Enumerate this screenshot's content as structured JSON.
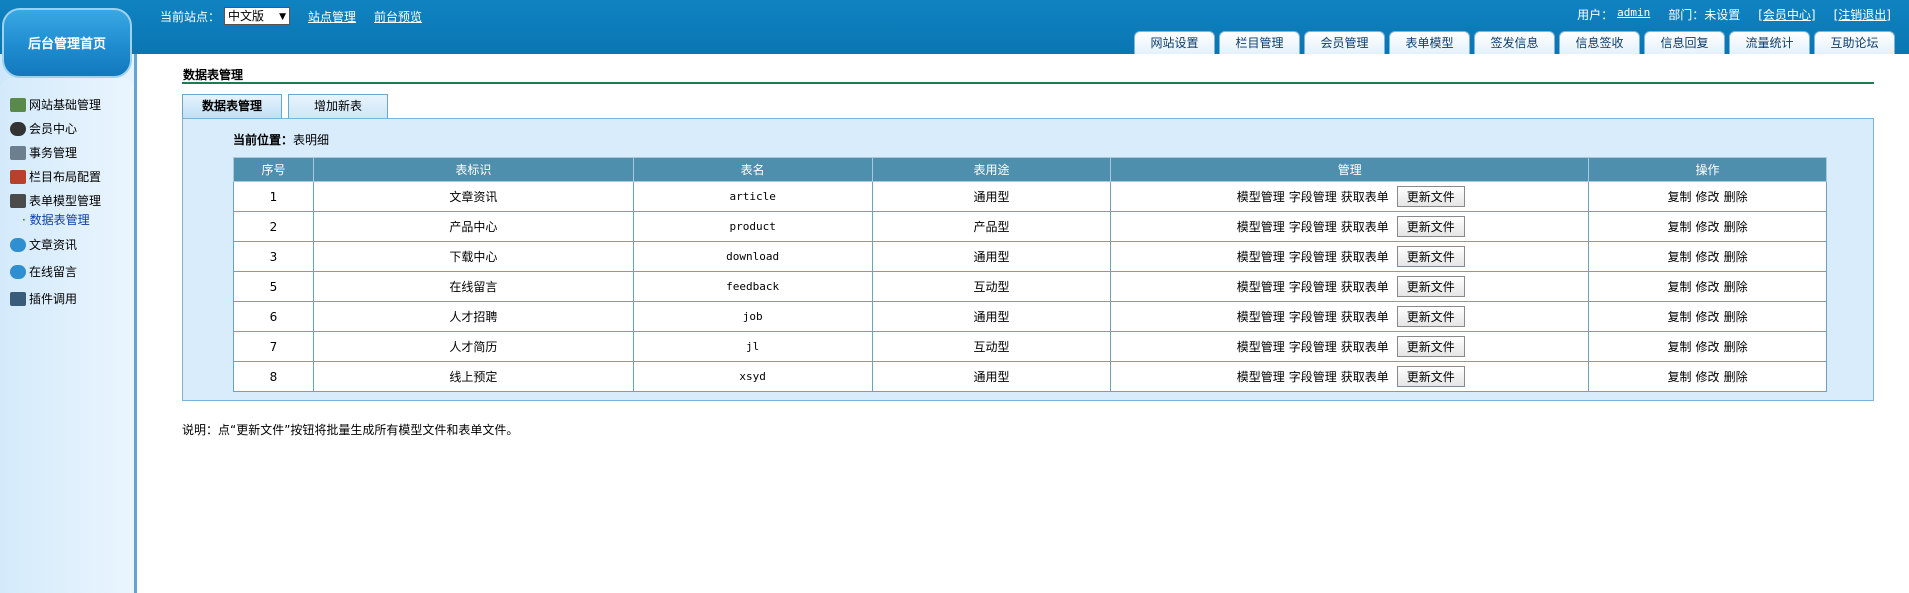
{
  "home_button": "后台管理首页",
  "site": {
    "label": "当前站点：",
    "selected": "中文版",
    "links": [
      "站点管理",
      "前台预览"
    ]
  },
  "user": {
    "user_label": "用户：",
    "user_name": "admin",
    "dept_label": "部门：未设置",
    "member_center": "[会员中心]",
    "logout": "[注销退出]"
  },
  "nav_tabs": [
    "网站设置",
    "栏目管理",
    "会员管理",
    "表单模型",
    "签发信息",
    "信息签收",
    "信息回复",
    "流量统计",
    "互助论坛"
  ],
  "sidebar": {
    "items": [
      "网站基础管理",
      "会员中心",
      "事务管理",
      "栏目布局配置",
      "表单模型管理",
      "文章资讯",
      "在线留言",
      "插件调用"
    ],
    "sub_item": "· 数据表管理"
  },
  "page_title": "数据表管理",
  "content_tabs": [
    "数据表管理",
    "增加新表"
  ],
  "location": {
    "label": "当前位置：",
    "value": "表明细"
  },
  "table": {
    "headers": [
      "序号",
      "表标识",
      "表名",
      "表用途",
      "管理",
      "操作"
    ],
    "manage_links": [
      "模型管理",
      "字段管理",
      "获取表单"
    ],
    "update_button": "更新文件",
    "ops": [
      "复制",
      "修改",
      "删除"
    ],
    "rows": [
      {
        "id": "1",
        "label": "文章资讯",
        "name": "article",
        "usage": "通用型"
      },
      {
        "id": "2",
        "label": "产品中心",
        "name": "product",
        "usage": "产品型"
      },
      {
        "id": "3",
        "label": "下载中心",
        "name": "download",
        "usage": "通用型"
      },
      {
        "id": "5",
        "label": "在线留言",
        "name": "feedback",
        "usage": "互动型"
      },
      {
        "id": "6",
        "label": "人才招聘",
        "name": "job",
        "usage": "通用型"
      },
      {
        "id": "7",
        "label": "人才简历",
        "name": "jl",
        "usage": "互动型"
      },
      {
        "id": "8",
        "label": "线上预定",
        "name": "xsyd",
        "usage": "通用型"
      }
    ]
  },
  "note": "说明：点“更新文件”按钮将批量生成所有模型文件和表单文件。"
}
